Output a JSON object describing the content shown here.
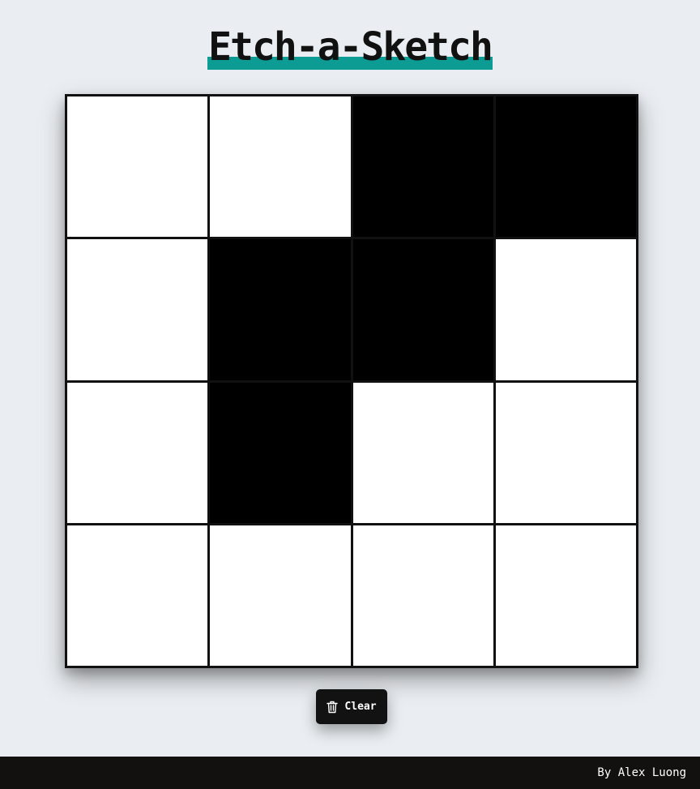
{
  "header": {
    "title": "Etch-a-Sketch",
    "underline_color": "#0d9c94"
  },
  "grid": {
    "columns": 4,
    "rows": 4,
    "cells": [
      [
        false,
        false,
        true,
        true
      ],
      [
        false,
        true,
        true,
        false
      ],
      [
        false,
        true,
        false,
        false
      ],
      [
        false,
        false,
        false,
        false
      ]
    ],
    "fill_color": "#000000",
    "empty_color": "#ffffff"
  },
  "controls": {
    "clear_label": "Clear",
    "clear_icon": "trash-icon"
  },
  "footer": {
    "credit": "By Alex Luong"
  }
}
